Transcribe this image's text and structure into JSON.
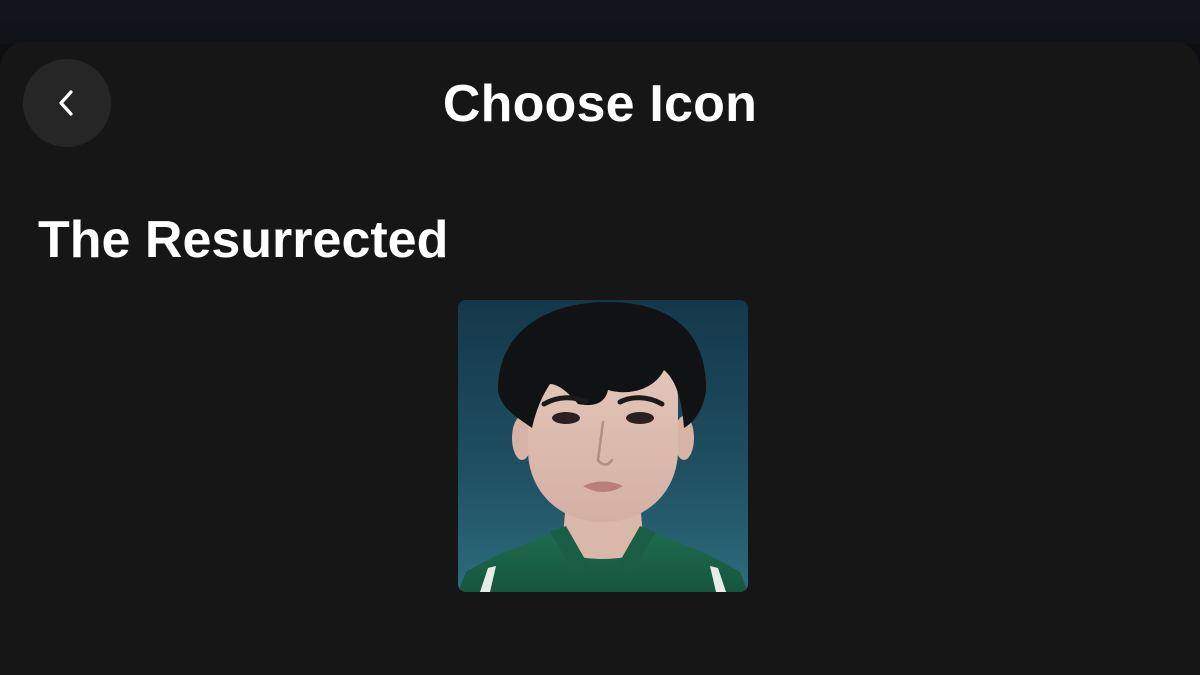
{
  "header": {
    "title": "Choose Icon",
    "back_icon": "chevron-left-icon"
  },
  "section": {
    "title": "The Resurrected"
  },
  "icons": [
    {
      "kind": "portrait",
      "background_color": "#1e4e60",
      "shirt_color": "#1f6b4f"
    }
  ],
  "colors": {
    "background": "#171616",
    "button_bg": "#262626",
    "text": "#ffffff"
  }
}
